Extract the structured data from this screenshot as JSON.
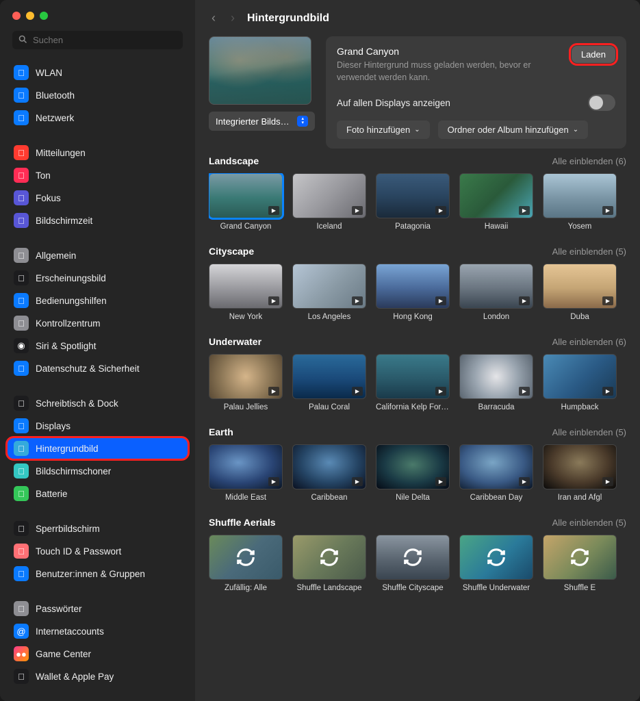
{
  "search": {
    "placeholder": "Suchen"
  },
  "sidebar": [
    {
      "label": "WLAN",
      "icon": "wifi-icon",
      "bg": "#0a7aff",
      "glyph": "􀙇"
    },
    {
      "label": "Bluetooth",
      "icon": "bluetooth-icon",
      "bg": "#0a7aff",
      "glyph": "􀖀"
    },
    {
      "label": "Netzwerk",
      "icon": "network-icon",
      "bg": "#0a7aff",
      "glyph": "􀤆"
    },
    {
      "gap": true
    },
    {
      "label": "Mitteilungen",
      "icon": "bell-icon",
      "bg": "#ff3b30",
      "glyph": "􀋚"
    },
    {
      "label": "Ton",
      "icon": "sound-icon",
      "bg": "#ff2d55",
      "glyph": "􀊨"
    },
    {
      "label": "Fokus",
      "icon": "moon-icon",
      "bg": "#5856d6",
      "glyph": "􀆺"
    },
    {
      "label": "Bildschirmzeit",
      "icon": "hourglass-icon",
      "bg": "#5856d6",
      "glyph": "􀖇"
    },
    {
      "gap": true
    },
    {
      "label": "Allgemein",
      "icon": "gear-icon",
      "bg": "#8e8e93",
      "glyph": "􀣋"
    },
    {
      "label": "Erscheinungsbild",
      "icon": "appearance-icon",
      "bg": "#1c1c1e",
      "glyph": "􀀻"
    },
    {
      "label": "Bedienungshilfen",
      "icon": "accessibility-icon",
      "bg": "#0a7aff",
      "glyph": "􀕾"
    },
    {
      "label": "Kontrollzentrum",
      "icon": "switches-icon",
      "bg": "#8e8e93",
      "glyph": "􀜊"
    },
    {
      "label": "Siri & Spotlight",
      "icon": "siri-icon",
      "bg": "#1c1c1e",
      "glyph": "◉"
    },
    {
      "label": "Datenschutz & Sicherheit",
      "icon": "hand-icon",
      "bg": "#0a7aff",
      "glyph": "􀉼"
    },
    {
      "gap": true
    },
    {
      "label": "Schreibtisch & Dock",
      "icon": "dock-icon",
      "bg": "#1c1c1e",
      "glyph": "􀒹"
    },
    {
      "label": "Displays",
      "icon": "display-icon",
      "bg": "#0a7aff",
      "glyph": "􀢹"
    },
    {
      "label": "Hintergrundbild",
      "icon": "wallpaper-icon",
      "bg": "#34aadc",
      "glyph": "􀏟",
      "selected": true,
      "highlight": true
    },
    {
      "label": "Bildschirmschoner",
      "icon": "screensaver-icon",
      "bg": "#34c7c2",
      "glyph": "􀏜"
    },
    {
      "label": "Batterie",
      "icon": "battery-icon",
      "bg": "#34c759",
      "glyph": "􀛨"
    },
    {
      "gap": true
    },
    {
      "label": "Sperrbildschirm",
      "icon": "lock-icon",
      "bg": "#1c1c1e",
      "glyph": "􀎡"
    },
    {
      "label": "Touch ID & Passwort",
      "icon": "fingerprint-icon",
      "bg": "#ff7075",
      "glyph": "􀟒"
    },
    {
      "label": "Benutzer:innen & Gruppen",
      "icon": "users-icon",
      "bg": "#0a7aff",
      "glyph": "􀉬"
    },
    {
      "gap": true
    },
    {
      "label": "Passwörter",
      "icon": "key-icon",
      "bg": "#8e8e93",
      "glyph": "􀟖"
    },
    {
      "label": "Internetaccounts",
      "icon": "at-icon",
      "bg": "#0a7aff",
      "glyph": "@"
    },
    {
      "label": "Game Center",
      "icon": "gamecenter-icon",
      "bg": "linear-gradient(135deg,#ff3b8d,#ff9500)",
      "glyph": "●●"
    },
    {
      "label": "Wallet & Apple Pay",
      "icon": "wallet-icon",
      "bg": "#1c1c1e",
      "glyph": "􀏰"
    }
  ],
  "header": {
    "title": "Hintergrundbild"
  },
  "hero": {
    "name": "Grand Canyon",
    "desc": "Dieser Hintergrund muss geladen werden, bevor er verwendet werden kann.",
    "load_btn": "Laden",
    "all_displays": "Auf allen Displays anzeigen"
  },
  "controls": {
    "display_select": "Integrierter Bildsc…",
    "add_photo": "Foto hinzufügen",
    "add_folder": "Ordner oder Album hinzufügen"
  },
  "sections": [
    {
      "title": "Landscape",
      "expand": "Alle einblenden (6)",
      "tiles": [
        {
          "name": "Grand Canyon",
          "sel": true,
          "grad": "linear-gradient(180deg,#7a9aa5,#3a7a75 55%,#2a5a55)"
        },
        {
          "name": "Iceland",
          "grad": "linear-gradient(135deg,#c5c5c8,#9a9a9f 50%,#6a6a70)"
        },
        {
          "name": "Patagonia",
          "grad": "linear-gradient(180deg,#3a5a7a,#2a4560 50%,#1a2a3a)"
        },
        {
          "name": "Hawaii",
          "grad": "linear-gradient(135deg,#3a7a4a,#2a5a3a 50%,#4aa5b5)"
        },
        {
          "name": "Yosem",
          "grad": "linear-gradient(180deg,#aac5d5,#7a95a5 55%,#5a7585)"
        }
      ]
    },
    {
      "title": "Cityscape",
      "expand": "Alle einblenden (5)",
      "tiles": [
        {
          "name": "New York",
          "grad": "linear-gradient(180deg,#d5d5d8,#9a9a9f 55%,#6a6a6f)"
        },
        {
          "name": "Los Angeles",
          "grad": "linear-gradient(135deg,#b5c5d5,#8a9aa5 55%,#6a7a85)"
        },
        {
          "name": "Hong Kong",
          "grad": "linear-gradient(180deg,#7aa5d5,#4a6a9a 55%,#2a3a5a)"
        },
        {
          "name": "London",
          "grad": "linear-gradient(180deg,#9aa5b0,#6a7580 55%,#3a4550)"
        },
        {
          "name": "Duba",
          "grad": "linear-gradient(180deg,#e5c595,#c5a575 55%,#8a6a4a)"
        }
      ]
    },
    {
      "title": "Underwater",
      "expand": "Alle einblenden (6)",
      "tiles": [
        {
          "name": "Palau Jellies",
          "grad": "radial-gradient(circle,#d5b58a,#8a7555 60%,#5a4a35)"
        },
        {
          "name": "Palau Coral",
          "grad": "linear-gradient(180deg,#2a6a9a,#1a4a7a 55%,#0a2a4a)"
        },
        {
          "name": "California Kelp Forest",
          "grad": "linear-gradient(180deg,#3a7a8a,#2a5a6a 55%,#1a3a4a)"
        },
        {
          "name": "Barracuda",
          "grad": "radial-gradient(circle,#e5e5e8,#9aa5b0 50%,#5a6570)"
        },
        {
          "name": "Humpback",
          "grad": "linear-gradient(135deg,#4a8ab5,#2a5a85 55%,#1a3a55)"
        }
      ]
    },
    {
      "title": "Earth",
      "expand": "Alle einblenden (5)",
      "tiles": [
        {
          "name": "Middle East",
          "grad": "radial-gradient(ellipse at 40% 40%,#6a95c5,#2a4575 55%,#0a1525)"
        },
        {
          "name": "Caribbean",
          "grad": "radial-gradient(ellipse at 50% 40%,#5a8ab5,#254565 55%,#0a1020)"
        },
        {
          "name": "Nile Delta",
          "grad": "radial-gradient(ellipse at 50% 45%,#4a7a6a,#1a3a45 55%,#050a15)"
        },
        {
          "name": "Caribbean Day",
          "grad": "radial-gradient(ellipse at 45% 40%,#7aa5c5,#3a5a85 55%,#0a1525)"
        },
        {
          "name": "Iran and Afgl",
          "grad": "radial-gradient(ellipse at 50% 40%,#8a7a5a,#4a3a2a 55%,#0a0a0a)"
        }
      ]
    },
    {
      "title": "Shuffle Aerials",
      "expand": "Alle einblenden (5)",
      "shuffle": true,
      "tiles": [
        {
          "name": "Zufällig: Alle",
          "grad": "linear-gradient(135deg,#6a8a5a,#4a6a7a 50%,#3a5a6a)"
        },
        {
          "name": "Shuffle Landscape",
          "grad": "linear-gradient(135deg,#9a9a6a,#6a7a5a 50%,#4a5a4a)"
        },
        {
          "name": "Shuffle Cityscape",
          "grad": "linear-gradient(180deg,#8a95a0,#5a6570 55%,#3a4550)"
        },
        {
          "name": "Shuffle Underwater",
          "grad": "linear-gradient(135deg,#4aa585,#2a7a9a 55%,#1a4a6a)"
        },
        {
          "name": "Shuffle E",
          "grad": "linear-gradient(135deg,#c5a56a,#7a8a5a 55%,#3a5a4a)"
        }
      ]
    }
  ]
}
